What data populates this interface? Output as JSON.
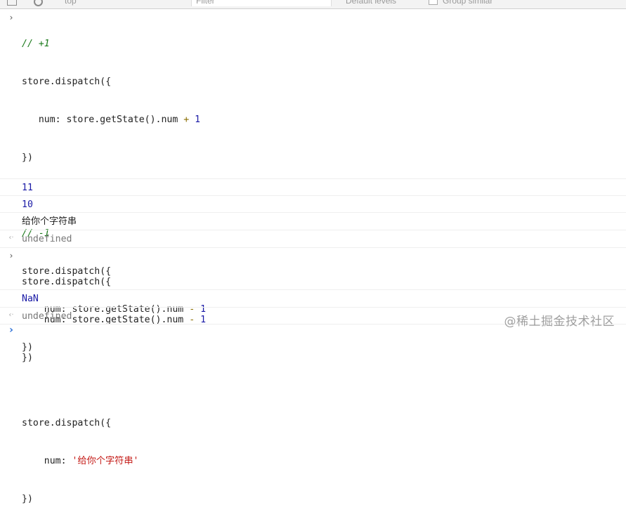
{
  "toolbar": {
    "context": "top",
    "filter_placeholder": "Filter",
    "levels": "Default levels",
    "group_similar": "Group similar"
  },
  "console": {
    "input1": {
      "comment1": "// +1",
      "l2": "store.dispatch({",
      "l3a": "   num: store.getState().num ",
      "l3op": "+",
      "l3num": "1",
      "l4": "})",
      "comment2": "// -1",
      "l7": "store.dispatch({",
      "l8a": "    num: store.getState().num ",
      "l8op": "-",
      "l8num": "1",
      "l9": "})",
      "l11": "store.dispatch({",
      "l12a": "    num: ",
      "l12str": "'给你个字符串'",
      "l13": "})"
    },
    "log1": "11",
    "log2": "10",
    "log3": "给你个字符串",
    "result1": "undefined",
    "input2": {
      "l1": "store.dispatch({",
      "l2a": "    num: store.getState().num ",
      "l2op": "-",
      "l2num": "1",
      "l3": "})"
    },
    "log4": "NaN",
    "result2": "undefined",
    "input_arrow": "›",
    "result_arrow": "‹·",
    "prompt_arrow": "›"
  },
  "watermark": "@稀土掘金技术社区",
  "colors": {
    "comment": "#1a7a1a",
    "number": "#1a1aa6",
    "string": "#c41a16",
    "prompt": "#2b6fd6"
  }
}
